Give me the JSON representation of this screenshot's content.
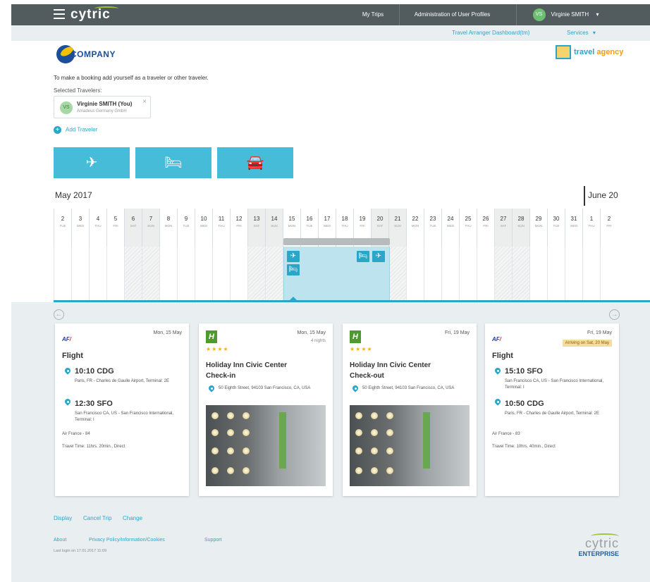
{
  "topbar": {
    "brand": "cytric",
    "my_trips": "My Trips",
    "admin": "Administration of User Profiles",
    "user_initials": "VS",
    "user_name": "Virginie SMITH",
    "user_caret": "▾"
  },
  "subbar": {
    "arranger": "Travel Arranger Dashboard(tm)",
    "services": "Services",
    "services_caret": "▾"
  },
  "company": {
    "name": "COMPANY"
  },
  "travel_agency": {
    "word1": "travel",
    "word2": "agency"
  },
  "booking": {
    "intro": "To make a booking add yourself as a traveler or other traveler.",
    "selected_label": "Selected Travelers:",
    "traveler": {
      "initials": "VS",
      "name": "Virginie SMITH (You)",
      "company": "Amadeus Germany GmbH",
      "remove": "×"
    },
    "add_traveler": "Add Traveler",
    "add_icon": "+"
  },
  "modes": [
    {
      "name": "flight",
      "icon": "plane-icon",
      "glyph": "✈"
    },
    {
      "name": "hotel",
      "icon": "bed-icon",
      "glyph": "🛏"
    },
    {
      "name": "car",
      "icon": "car-icon",
      "glyph": "🚘"
    }
  ],
  "timeline": {
    "month_current": "May 2017",
    "month_next": "June 20",
    "days": [
      {
        "n": "2",
        "w": "TUE"
      },
      {
        "n": "3",
        "w": "WED"
      },
      {
        "n": "4",
        "w": "THU"
      },
      {
        "n": "5",
        "w": "FRI"
      },
      {
        "n": "6",
        "w": "SAT"
      },
      {
        "n": "7",
        "w": "SUN"
      },
      {
        "n": "8",
        "w": "MON"
      },
      {
        "n": "9",
        "w": "TUE"
      },
      {
        "n": "10",
        "w": "WED"
      },
      {
        "n": "11",
        "w": "THU"
      },
      {
        "n": "12",
        "w": "FRI"
      },
      {
        "n": "13",
        "w": "SAT"
      },
      {
        "n": "14",
        "w": "SUN"
      },
      {
        "n": "15",
        "w": "MON"
      },
      {
        "n": "16",
        "w": "TUE"
      },
      {
        "n": "17",
        "w": "WED"
      },
      {
        "n": "18",
        "w": "THU"
      },
      {
        "n": "19",
        "w": "FRI"
      },
      {
        "n": "20",
        "w": "SAT"
      },
      {
        "n": "21",
        "w": "SUN"
      },
      {
        "n": "22",
        "w": "MON"
      },
      {
        "n": "23",
        "w": "TUE"
      },
      {
        "n": "24",
        "w": "WED"
      },
      {
        "n": "25",
        "w": "THU"
      },
      {
        "n": "26",
        "w": "FRI"
      },
      {
        "n": "27",
        "w": "SAT"
      },
      {
        "n": "28",
        "w": "SUN"
      },
      {
        "n": "29",
        "w": "MON"
      },
      {
        "n": "30",
        "w": "TUE"
      },
      {
        "n": "31",
        "w": "WED"
      },
      {
        "n": "1",
        "w": "THU"
      },
      {
        "n": "2",
        "w": "FRI"
      }
    ],
    "events": {
      "plane": "✈",
      "bed": "🛏"
    }
  },
  "nav": {
    "prev": "←",
    "next": "→"
  },
  "cards": [
    {
      "type": "flight",
      "airline": "AF",
      "date": "Mon, 15 May",
      "title": "Flight",
      "dep_time": "10:10 CDG",
      "dep_addr": "Paris, FR - Charles de Gaulle Airport, Terminal: 2E",
      "arr_time": "12:30 SFO",
      "arr_addr": "San Francisco CA, US - San Francisco International, Terminal: I",
      "flight": "Air France - 84",
      "travel_time": "Travel Time: 11hrs. 20min., Direct"
    },
    {
      "type": "hotel",
      "logo": "H",
      "date": "Mon, 15 May",
      "nights": "4 nights",
      "stars": "★★★★",
      "name": "Holiday Inn Civic Center",
      "action": "Check-in",
      "address": "50 Eighth Street, 94103 San Francisco, CA, USA"
    },
    {
      "type": "hotel",
      "logo": "H",
      "date": "Fri, 19 May",
      "stars": "★★★★",
      "name": "Holiday Inn Civic Center",
      "action": "Check-out",
      "address": "50 Eighth Street, 94103 San Francisco, CA, USA"
    },
    {
      "type": "flight",
      "airline": "AF",
      "date": "Fri, 19 May",
      "badge": "Arriving on Sat, 20 May",
      "title": "Flight",
      "dep_time": "15:10 SFO",
      "dep_addr": "San Francisco CA, US - San Francisco International, Terminal: I",
      "arr_time": "10:50 CDG",
      "arr_addr": "Paris, FR - Charles de Gaulle Airport, Terminal: 2E",
      "flight": "Air France - 83",
      "travel_time": "Travel Time: 10hrs. 40min., Direct"
    }
  ],
  "actions": {
    "display": "Display",
    "cancel": "Cancel Trip",
    "change": "Change"
  },
  "footer": {
    "about": "About",
    "privacy": "Privacy Policy/Information/Cookies",
    "support": "Support",
    "last_login": "Last login on 17.01.2017 11:09",
    "logo_main": "cytric",
    "logo_sub": "ENTERPRISE"
  }
}
